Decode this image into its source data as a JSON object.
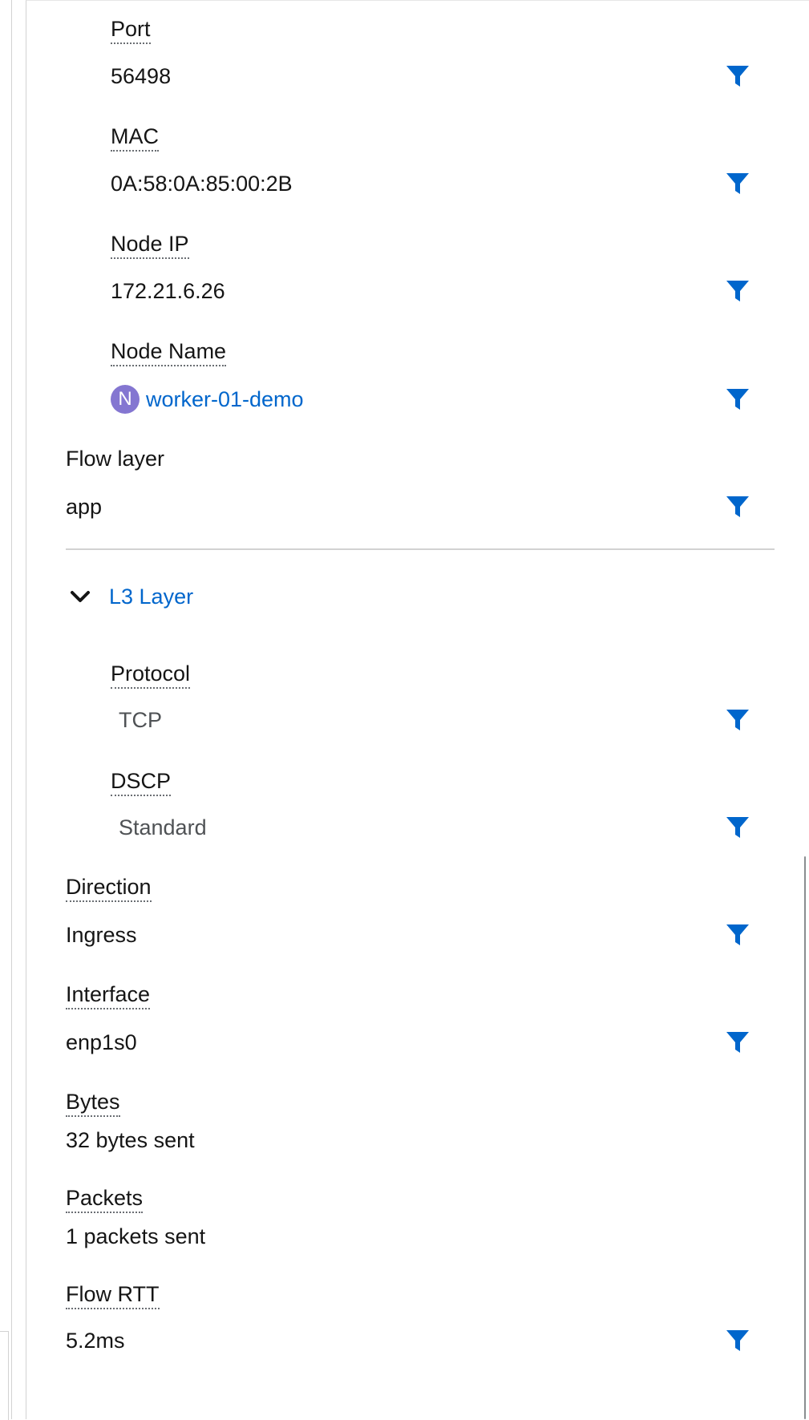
{
  "fields": {
    "port": {
      "label": "Port",
      "value": "56498"
    },
    "mac": {
      "label": "MAC",
      "value": "0A:58:0A:85:00:2B"
    },
    "node_ip": {
      "label": "Node IP",
      "value": "172.21.6.26"
    },
    "node_name": {
      "label": "Node Name",
      "badge": "N",
      "value": "worker-01-demo"
    },
    "flow_layer": {
      "label": "Flow layer",
      "value": "app"
    },
    "protocol": {
      "label": "Protocol",
      "value": "TCP"
    },
    "dscp": {
      "label": "DSCP",
      "value": "Standard"
    },
    "direction": {
      "label": "Direction",
      "value": "Ingress"
    },
    "interface": {
      "label": "Interface",
      "value": "enp1s0"
    },
    "bytes": {
      "label": "Bytes",
      "value": "32 bytes sent"
    },
    "packets": {
      "label": "Packets",
      "value": "1 packets sent"
    },
    "flow_rtt": {
      "label": "Flow RTT",
      "value": "5.2ms"
    }
  },
  "section": {
    "title": "L3 Layer",
    "expanded": true,
    "icon": "chevron-down-icon"
  },
  "icons": {
    "filter": "filter-icon"
  },
  "colors": {
    "accent": "#0066cc",
    "badge": "#8476d1",
    "text": "#151515",
    "divider": "#d2d2d2"
  }
}
